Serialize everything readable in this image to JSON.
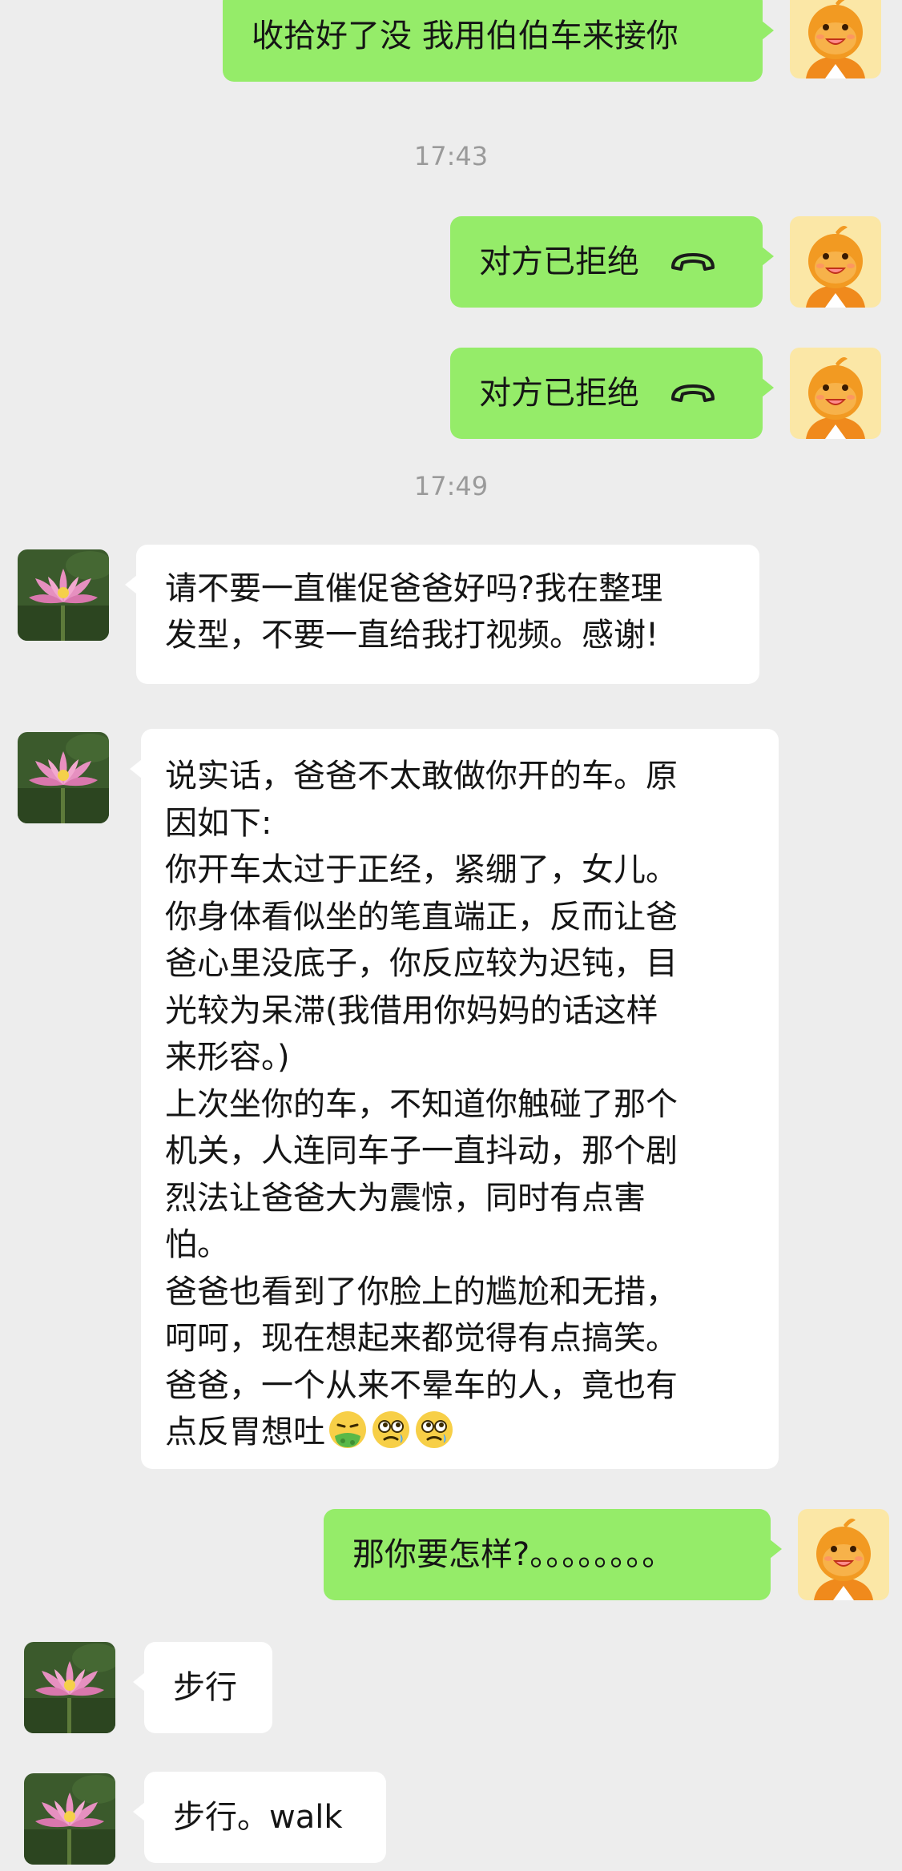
{
  "messages": {
    "m1": {
      "text": "收拾好了没 我用伯伯车来接你"
    },
    "t1": {
      "text": "17:43"
    },
    "m2": {
      "text": "对方已拒绝"
    },
    "m3": {
      "text": "对方已拒绝"
    },
    "t2": {
      "text": "17:49"
    },
    "m4": {
      "text": "请不要一直催促爸爸好吗?我在整理\n发型，不要一直给我打视频。感谢!"
    },
    "m5": {
      "text": "说实话，爸爸不太敢做你开的车。原\n因如下:\n你开车太过于正经，紧绷了，女儿。\n你身体看似坐的笔直端正，反而让爸\n爸心里没底子，你反应较为迟钝，目\n光较为呆滞(我借用你妈妈的话这样\n来形容。)\n上次坐你的车，不知道你触碰了那个\n机关，人连同车子一直抖动，那个剧\n烈法让爸爸大为震惊，同时有点害\n怕。\n爸爸也看到了你脸上的尴尬和无措，\n呵呵，现在想起来都觉得有点搞笑。\n爸爸，一个从来不晕车的人，竟也有\n点反胃想吐"
    },
    "m6": {
      "text": "那你要怎样?。。。。。。。。"
    },
    "m7": {
      "text": "步行"
    },
    "m8": {
      "text": "步行。walk"
    }
  },
  "icons": {
    "self_avatar": "cartoon-orange-avatar-icon",
    "other_avatar": "lotus-flower-avatar-icon",
    "call": "phone-hangup-icon",
    "emojis": [
      "nauseated-emoji-icon",
      "dizzy-emoji-icon",
      "dizzy-emoji-icon"
    ]
  },
  "colors": {
    "outgoing_bubble": "#95ec69",
    "incoming_bubble": "#ffffff",
    "background": "#ededed",
    "timestamp": "#9a9a9a"
  }
}
